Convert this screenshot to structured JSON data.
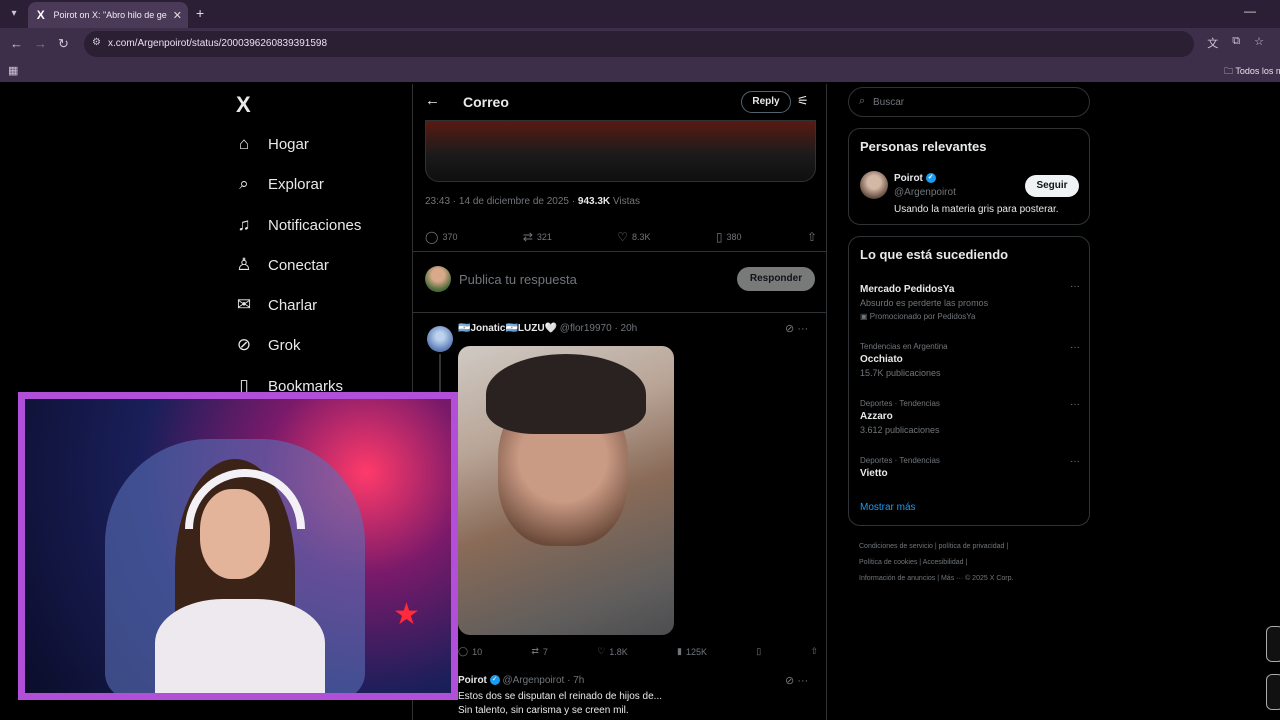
{
  "browser": {
    "tab_title": "Poirot on X: \"Abro hilo de gente",
    "tab_favicon": "X",
    "url": "x.com/Argenpoirot/status/2000396260839391598",
    "bookmarks_all": "Todos los m"
  },
  "nav": {
    "logo": "X",
    "items": [
      {
        "label": "Hogar",
        "icon": "home-icon"
      },
      {
        "label": "Explorar",
        "icon": "search-icon"
      },
      {
        "label": "Notificaciones",
        "icon": "bell-icon"
      },
      {
        "label": "Conectar",
        "icon": "add-person-icon"
      },
      {
        "label": "Charlar",
        "icon": "mail-icon"
      },
      {
        "label": "Grok",
        "icon": "grok-icon"
      },
      {
        "label": "Bookmarks",
        "icon": "bookmark-icon"
      }
    ]
  },
  "post": {
    "header_title": "Correo",
    "reply_label": "Reply",
    "timestamp": "23:43 · 14 de diciembre de 2025 · ",
    "views": "943.3K",
    "views_label": " Vistas",
    "replies": "370",
    "reposts": "321",
    "likes": "8.3K",
    "bookmarks": "380",
    "compose_placeholder": "Publica tu respuesta",
    "respond_button": "Responder"
  },
  "reply1": {
    "name": "🇦🇷Jonatic🇦🇷LUZU🤍",
    "handle": " @flor19970 · 20h",
    "replies": "10",
    "reposts": "7",
    "likes": "1.8K",
    "views": "125K"
  },
  "reply2": {
    "name": "Poirot",
    "handle": " @Argenpoirot · 7h",
    "text_line1": "Estos dos se disputan el reinado de hijos de...",
    "text_line2": "Sin talento, sin carisma y se creen mil."
  },
  "right": {
    "search_placeholder": "Buscar",
    "relevant_title": "Personas relevantes",
    "relevant_name": "Poirot",
    "relevant_handle": "@Argenpoirot",
    "relevant_bio": "Usando la materia gris para posterar.",
    "follow_label": "Seguir",
    "trends_title": "Lo que está sucediendo",
    "trends": [
      {
        "context": "",
        "title": "Mercado PedidosYa",
        "sub": "Absurdo es perderte las promos",
        "extra": "Promocionado por PedidosYa"
      },
      {
        "context": "Tendencias en Argentina",
        "title": "Occhiato",
        "sub": "15.7K publicaciones",
        "extra": ""
      },
      {
        "context": "Deportes · Tendencias",
        "title": "Azzaro",
        "sub": "3.612 publicaciones",
        "extra": ""
      },
      {
        "context": "Deportes · Tendencias",
        "title": "Vietto",
        "sub": "",
        "extra": ""
      }
    ],
    "show_more": "Mostrar más",
    "footer_line1": "Condiciones de servicio  |  política de privacidad  |",
    "footer_line2": "Política de cookies  |  Accesibilidad  |",
    "footer_line3": "Información de anuncios  |  Más ···  © 2025 X Corp."
  },
  "colors": {
    "accent": "#1d9bf0",
    "chrome": "#3d2f4a",
    "webcam_border": "#b24fd8"
  }
}
